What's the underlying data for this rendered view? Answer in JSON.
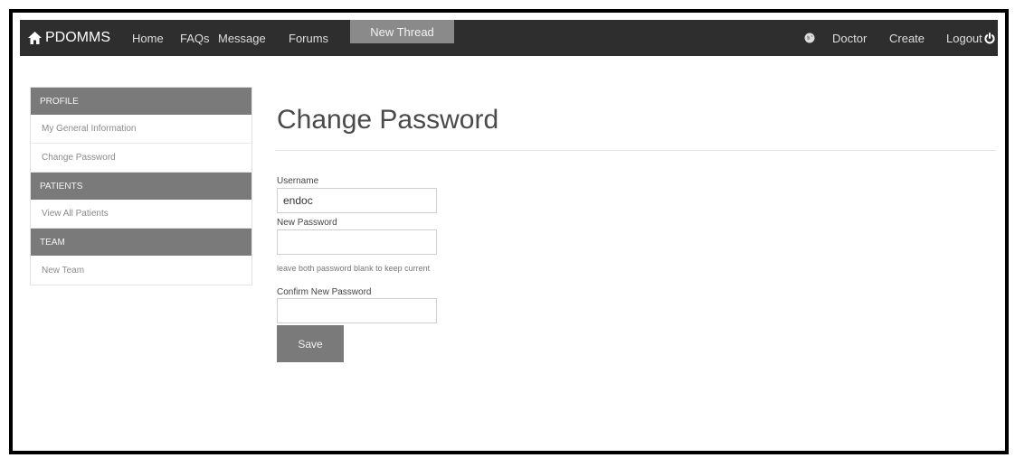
{
  "nav": {
    "brand": "PDOMMS",
    "home": "Home",
    "faqs": "FAQs",
    "message": "Message",
    "forums": "Forums",
    "new_thread": "New Thread",
    "doctor": "Doctor",
    "create": "Create",
    "logout": "Logout"
  },
  "sidebar": {
    "profile_header": "PROFILE",
    "general_info": "My General Information",
    "change_password": "Change Password",
    "patients_header": "PATIENTS",
    "view_patients": "View All Patients",
    "team_header": "TEAM",
    "new_team": "New Team"
  },
  "main": {
    "title": "Change Password",
    "username_label": "Username",
    "username_value": "endoc",
    "new_password_label": "New Password",
    "new_password_value": "",
    "help_text": "leave both password blank to keep current",
    "confirm_label": "Confirm New Password",
    "confirm_value": "",
    "save_label": "Save"
  },
  "colors": {
    "navbar": "#2e2e2e",
    "active_tab": "#8a8a8a",
    "section_header": "#7a7a7a",
    "button": "#7a7a7a"
  }
}
